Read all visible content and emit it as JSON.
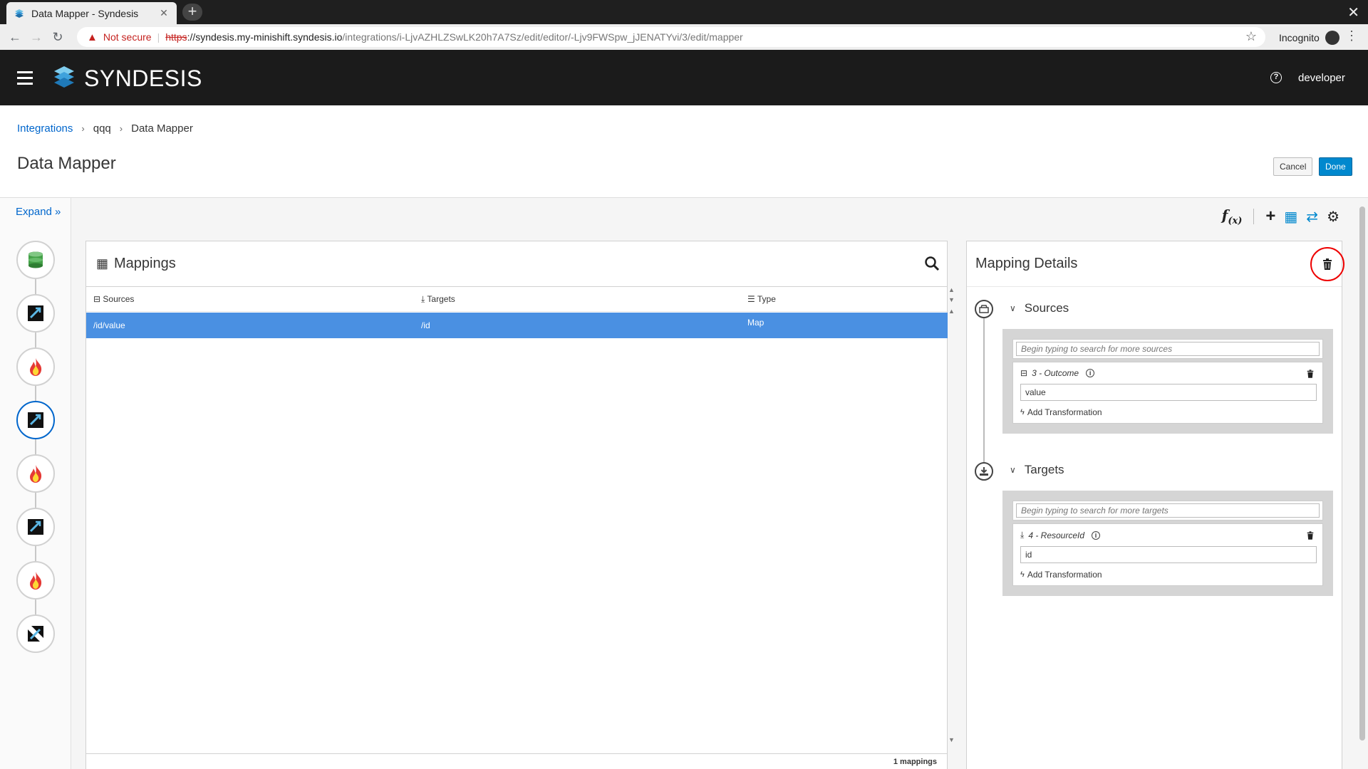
{
  "browser": {
    "tab_title": "Data Mapper - Syndesis",
    "not_secure": "Not secure",
    "url_scheme": "https",
    "url_host": "://syndesis.my-minishift.syndesis.io",
    "url_path": "/integrations/i-LjvAZHLZSwLK20h7A7Sz/edit/editor/-Ljv9FWSpw_jJENATYvi/3/edit/mapper",
    "incognito": "Incognito"
  },
  "header": {
    "brand": "SYNDESIS",
    "user": "developer"
  },
  "breadcrumb": {
    "items": [
      "Integrations",
      "qqq",
      "Data Mapper"
    ]
  },
  "page": {
    "title": "Data Mapper",
    "cancel": "Cancel",
    "done": "Done"
  },
  "leftrail": {
    "expand": "Expand"
  },
  "mappings": {
    "title": "Mappings",
    "columns": [
      "Sources",
      "Targets",
      "Type"
    ],
    "rows": [
      {
        "source": "/id/value",
        "target": "/id",
        "type": "Map"
      }
    ],
    "footer": "1 mappings"
  },
  "details": {
    "title": "Mapping Details",
    "sources": {
      "label": "Sources",
      "search_placeholder": "Begin typing to search for more sources",
      "field_name": "3 - Outcome",
      "field_value": "value",
      "add_transformation": "Add Transformation"
    },
    "targets": {
      "label": "Targets",
      "search_placeholder": "Begin typing to search for more targets",
      "field_name": "4 - ResourceId",
      "field_value": "id",
      "add_transformation": "Add Transformation"
    }
  },
  "colors": {
    "accent": "#0088ce",
    "selected_row": "#4a90e2",
    "header_bg": "#1b1b1b",
    "highlight_ring": "#ee0000"
  }
}
